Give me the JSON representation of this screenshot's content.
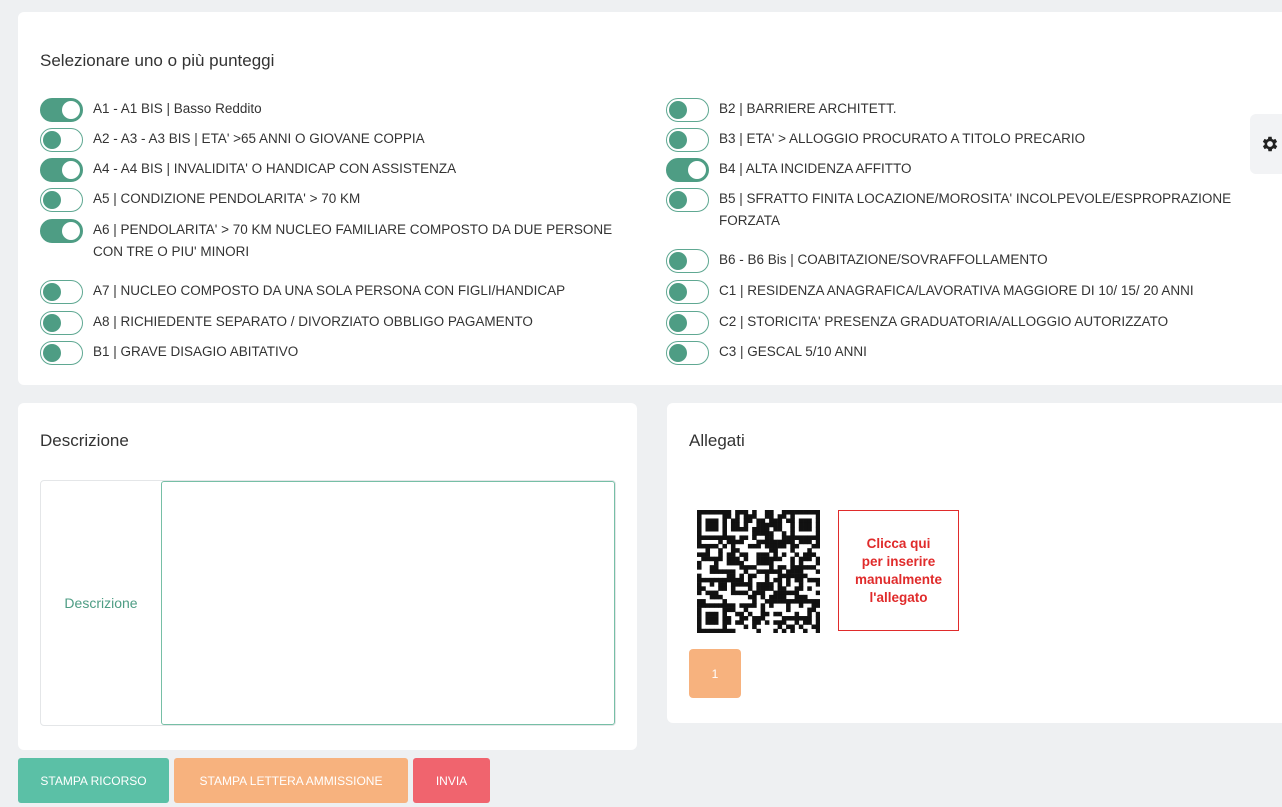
{
  "scores": {
    "title": "Selezionare uno o più punteggi",
    "left": [
      {
        "label": "A1 - A1 BIS | Basso Reddito",
        "on": true
      },
      {
        "label": "A2 - A3 - A3 BIS | ETA' >65 ANNI O GIOVANE COPPIA",
        "on": false
      },
      {
        "label": "A4 - A4 BIS | INVALIDITA' O HANDICAP CON ASSISTENZA",
        "on": true
      },
      {
        "label": "A5 | CONDIZIONE PENDOLARITA' > 70 KM",
        "on": false
      },
      {
        "label": "A6 | PENDOLARITA' > 70 KM NUCLEO FAMILIARE COMPOSTO DA DUE PERSONE CON TRE O PIU' MINORI",
        "on": true
      },
      {
        "label": "A7 | NUCLEO COMPOSTO DA UNA SOLA PERSONA CON FIGLI/HANDICAP",
        "on": false
      },
      {
        "label": "A8 | RICHIEDENTE SEPARATO / DIVORZIATO OBBLIGO PAGAMENTO",
        "on": false
      },
      {
        "label": "B1 | GRAVE DISAGIO ABITATIVO",
        "on": false
      }
    ],
    "right": [
      {
        "label": "B2 | BARRIERE ARCHITETT.",
        "on": false
      },
      {
        "label": "B3 | ETA' > ALLOGGIO PROCURATO A TITOLO PRECARIO",
        "on": false
      },
      {
        "label": "B4 | ALTA INCIDENZA AFFITTO",
        "on": true
      },
      {
        "label": "B5 | SFRATTO FINITA LOCAZIONE/MOROSITA' INCOLPEVOLE/ESPROPRAZIONE FORZATA",
        "on": false
      },
      {
        "label": "B6 - B6 Bis | COABITAZIONE/SOVRAFFOLLAMENTO",
        "on": false
      },
      {
        "label": "C1 | RESIDENZA ANAGRAFICA/LAVORATIVA MAGGIORE DI 10/ 15/ 20 ANNI",
        "on": false
      },
      {
        "label": "C2 | STORICITA' PRESENZA GRADUATORIA/ALLOGGIO AUTORIZZATO",
        "on": false
      },
      {
        "label": "C3 | GESCAL 5/10 ANNI",
        "on": false
      }
    ]
  },
  "descrizione": {
    "title": "Descrizione",
    "field_label": "Descrizione",
    "value": ""
  },
  "allegati": {
    "title": "Allegati",
    "manual_line1": "Clicca qui",
    "manual_line2": "per inserire",
    "manual_line3": "manualmente",
    "manual_line4": "l'allegato",
    "page": "1"
  },
  "actions": {
    "stampa_ricorso": "STAMPA RICORSO",
    "stampa_lettera": "STAMPA LETTERA AMMISSIONE",
    "invia": "INVIA"
  },
  "colors": {
    "accent": "#4e9d84",
    "orange": "#f7b27e",
    "red": "#f0646e",
    "teal_button": "#5bc0a6"
  },
  "icons": {
    "settings": "gear-icon",
    "qr": "qr-code-icon"
  }
}
